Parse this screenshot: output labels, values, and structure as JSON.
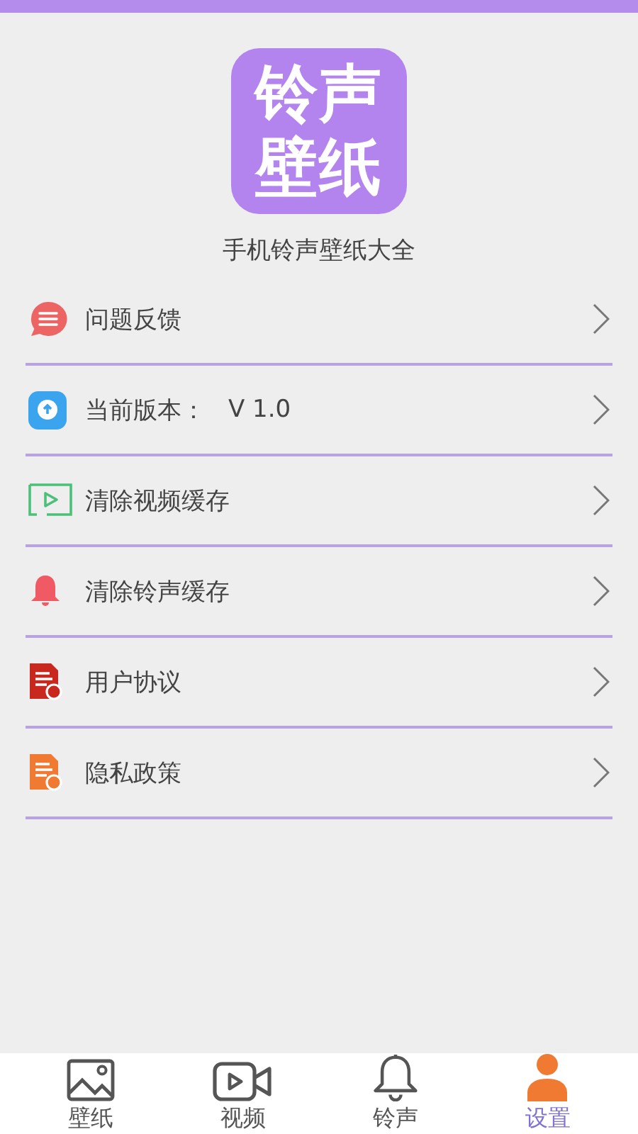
{
  "logo": {
    "lines": [
      "铃声",
      "壁纸"
    ]
  },
  "app_name": "手机铃声壁纸大全",
  "menu": [
    {
      "label": "问题反馈"
    },
    {
      "label": "当前版本：",
      "value": "V 1.0"
    },
    {
      "label": "清除视频缓存"
    },
    {
      "label": "清除铃声缓存"
    },
    {
      "label": "用户协议"
    },
    {
      "label": "隐私政策"
    }
  ],
  "tabs": [
    {
      "label": "壁纸",
      "selected": false
    },
    {
      "label": "视频",
      "selected": false
    },
    {
      "label": "铃声",
      "selected": false
    },
    {
      "label": "设置",
      "selected": true
    }
  ]
}
